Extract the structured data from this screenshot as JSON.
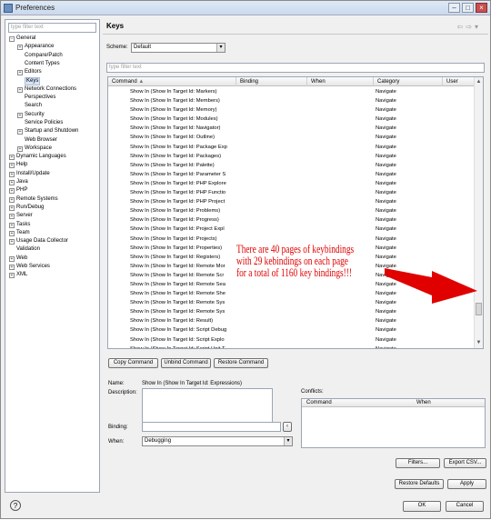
{
  "window": {
    "title": "Preferences"
  },
  "sidebar": {
    "filter_placeholder": "type filter text",
    "tree": [
      {
        "label": "General",
        "depth": 0,
        "expander": "−"
      },
      {
        "label": "Appearance",
        "depth": 1,
        "expander": "+"
      },
      {
        "label": "Compare/Patch",
        "depth": 1,
        "expander": ""
      },
      {
        "label": "Content Types",
        "depth": 1,
        "expander": ""
      },
      {
        "label": "Editors",
        "depth": 1,
        "expander": "+"
      },
      {
        "label": "Keys",
        "depth": 1,
        "expander": "",
        "selected": true
      },
      {
        "label": "Network Connections",
        "depth": 1,
        "expander": "+"
      },
      {
        "label": "Perspectives",
        "depth": 1,
        "expander": ""
      },
      {
        "label": "Search",
        "depth": 1,
        "expander": ""
      },
      {
        "label": "Security",
        "depth": 1,
        "expander": "+"
      },
      {
        "label": "Service Policies",
        "depth": 1,
        "expander": ""
      },
      {
        "label": "Startup and Shutdown",
        "depth": 1,
        "expander": "+"
      },
      {
        "label": "Web Browser",
        "depth": 1,
        "expander": ""
      },
      {
        "label": "Workspace",
        "depth": 1,
        "expander": "+"
      },
      {
        "label": "Dynamic Languages",
        "depth": 0,
        "expander": "+"
      },
      {
        "label": "Help",
        "depth": 0,
        "expander": "+"
      },
      {
        "label": "Install/Update",
        "depth": 0,
        "expander": "+"
      },
      {
        "label": "Java",
        "depth": 0,
        "expander": "+"
      },
      {
        "label": "PHP",
        "depth": 0,
        "expander": "+"
      },
      {
        "label": "Remote Systems",
        "depth": 0,
        "expander": "+"
      },
      {
        "label": "Run/Debug",
        "depth": 0,
        "expander": "+"
      },
      {
        "label": "Server",
        "depth": 0,
        "expander": "+"
      },
      {
        "label": "Tasks",
        "depth": 0,
        "expander": "+"
      },
      {
        "label": "Team",
        "depth": 0,
        "expander": "+"
      },
      {
        "label": "Usage Data Collector",
        "depth": 0,
        "expander": "+"
      },
      {
        "label": "Validation",
        "depth": 0,
        "expander": ""
      },
      {
        "label": "Web",
        "depth": 0,
        "expander": "+"
      },
      {
        "label": "Web Services",
        "depth": 0,
        "expander": "+"
      },
      {
        "label": "XML",
        "depth": 0,
        "expander": "+"
      }
    ]
  },
  "keys": {
    "title": "Keys",
    "scheme_label": "Scheme:",
    "scheme_value": "Default",
    "filter_placeholder": "type filter text",
    "columns": [
      "Command",
      "Binding",
      "When",
      "Category",
      "User"
    ],
    "rows": [
      {
        "command": "Show In (Show In Target Id: Markers)",
        "category": "Navigate"
      },
      {
        "command": "Show In (Show In Target Id: Members)",
        "category": "Navigate"
      },
      {
        "command": "Show In (Show In Target Id: Memory)",
        "category": "Navigate"
      },
      {
        "command": "Show In (Show In Target Id: Modules)",
        "category": "Navigate"
      },
      {
        "command": "Show In (Show In Target Id: Navigator)",
        "category": "Navigate"
      },
      {
        "command": "Show In (Show In Target Id: Outline)",
        "category": "Navigate"
      },
      {
        "command": "Show In (Show In Target Id: Package Exp",
        "category": "Navigate"
      },
      {
        "command": "Show In (Show In Target Id: Packages)",
        "category": "Navigate"
      },
      {
        "command": "Show In (Show In Target Id: Palette)",
        "category": "Navigate"
      },
      {
        "command": "Show In (Show In Target Id: Parameter S",
        "category": "Navigate"
      },
      {
        "command": "Show In (Show In Target Id: PHP Explore",
        "category": "Navigate"
      },
      {
        "command": "Show In (Show In Target Id: PHP Functio",
        "category": "Navigate"
      },
      {
        "command": "Show In (Show In Target Id: PHP Project",
        "category": "Navigate"
      },
      {
        "command": "Show In (Show In Target Id: Problems)",
        "category": "Navigate"
      },
      {
        "command": "Show In (Show In Target Id: Progress)",
        "category": "Navigate"
      },
      {
        "command": "Show In (Show In Target Id: Project Expl",
        "category": "Navigate"
      },
      {
        "command": "Show In (Show In Target Id: Projects)",
        "category": "Navigate"
      },
      {
        "command": "Show In (Show In Target Id: Properties)",
        "category": "Navigate"
      },
      {
        "command": "Show In (Show In Target Id: Registers)",
        "category": "Navigate"
      },
      {
        "command": "Show In (Show In Target Id: Remote Mor",
        "category": "Navigate"
      },
      {
        "command": "Show In (Show In Target Id: Remote Scr",
        "category": "Navigate"
      },
      {
        "command": "Show In (Show In Target Id: Remote Sea",
        "category": "Navigate"
      },
      {
        "command": "Show In (Show In Target Id: Remote She",
        "category": "Navigate"
      },
      {
        "command": "Show In (Show In Target Id: Remote Sys",
        "category": "Navigate"
      },
      {
        "command": "Show In (Show In Target Id: Remote Sys",
        "category": "Navigate"
      },
      {
        "command": "Show In (Show In Target Id: Result)",
        "category": "Navigate"
      },
      {
        "command": "Show In (Show In Target Id: Script Debug",
        "category": "Navigate"
      },
      {
        "command": "Show In (Show In Target Id: Script Explo",
        "category": "Navigate"
      },
      {
        "command": "Show In (Show In Target Id: Script Unit T",
        "category": "Navigate"
      }
    ],
    "buttons": {
      "copy": "Copy Command",
      "unbind": "Unbind Command",
      "restore": "Restore Command"
    },
    "details": {
      "name_label": "Name:",
      "name_value": "Show In (Show In Target Id: Expressions)",
      "description_label": "Description:",
      "binding_label": "Binding:",
      "when_label": "When:",
      "when_value": "Debugging",
      "conflicts_label": "Conflicts:",
      "conflict_columns": [
        "Command",
        "When"
      ]
    },
    "filters_button": "Filters...",
    "export_button": "Export CSV...",
    "restore_defaults_button": "Restore Defaults",
    "apply_button": "Apply"
  },
  "annotation": {
    "line1": "There are 40 pages of keybindings",
    "line2": "with 29 kebindings on each page",
    "line3": "for a total of 1160 key bindings!!!",
    "color": "#e00000"
  },
  "footer": {
    "help_icon": "?",
    "ok_button": "OK",
    "cancel_button": "Cancel"
  }
}
